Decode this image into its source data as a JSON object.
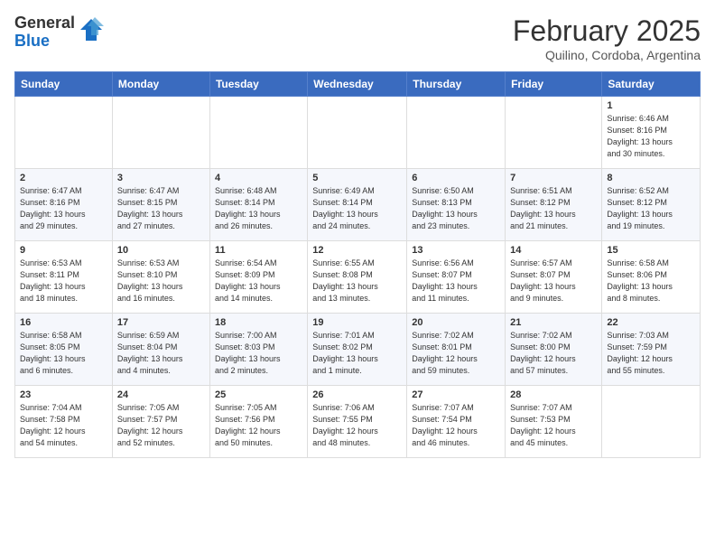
{
  "logo": {
    "general": "General",
    "blue": "Blue"
  },
  "title": "February 2025",
  "location": "Quilino, Cordoba, Argentina",
  "days_of_week": [
    "Sunday",
    "Monday",
    "Tuesday",
    "Wednesday",
    "Thursday",
    "Friday",
    "Saturday"
  ],
  "weeks": [
    [
      {
        "day": "",
        "info": ""
      },
      {
        "day": "",
        "info": ""
      },
      {
        "day": "",
        "info": ""
      },
      {
        "day": "",
        "info": ""
      },
      {
        "day": "",
        "info": ""
      },
      {
        "day": "",
        "info": ""
      },
      {
        "day": "1",
        "info": "Sunrise: 6:46 AM\nSunset: 8:16 PM\nDaylight: 13 hours\nand 30 minutes."
      }
    ],
    [
      {
        "day": "2",
        "info": "Sunrise: 6:47 AM\nSunset: 8:16 PM\nDaylight: 13 hours\nand 29 minutes."
      },
      {
        "day": "3",
        "info": "Sunrise: 6:47 AM\nSunset: 8:15 PM\nDaylight: 13 hours\nand 27 minutes."
      },
      {
        "day": "4",
        "info": "Sunrise: 6:48 AM\nSunset: 8:14 PM\nDaylight: 13 hours\nand 26 minutes."
      },
      {
        "day": "5",
        "info": "Sunrise: 6:49 AM\nSunset: 8:14 PM\nDaylight: 13 hours\nand 24 minutes."
      },
      {
        "day": "6",
        "info": "Sunrise: 6:50 AM\nSunset: 8:13 PM\nDaylight: 13 hours\nand 23 minutes."
      },
      {
        "day": "7",
        "info": "Sunrise: 6:51 AM\nSunset: 8:12 PM\nDaylight: 13 hours\nand 21 minutes."
      },
      {
        "day": "8",
        "info": "Sunrise: 6:52 AM\nSunset: 8:12 PM\nDaylight: 13 hours\nand 19 minutes."
      }
    ],
    [
      {
        "day": "9",
        "info": "Sunrise: 6:53 AM\nSunset: 8:11 PM\nDaylight: 13 hours\nand 18 minutes."
      },
      {
        "day": "10",
        "info": "Sunrise: 6:53 AM\nSunset: 8:10 PM\nDaylight: 13 hours\nand 16 minutes."
      },
      {
        "day": "11",
        "info": "Sunrise: 6:54 AM\nSunset: 8:09 PM\nDaylight: 13 hours\nand 14 minutes."
      },
      {
        "day": "12",
        "info": "Sunrise: 6:55 AM\nSunset: 8:08 PM\nDaylight: 13 hours\nand 13 minutes."
      },
      {
        "day": "13",
        "info": "Sunrise: 6:56 AM\nSunset: 8:07 PM\nDaylight: 13 hours\nand 11 minutes."
      },
      {
        "day": "14",
        "info": "Sunrise: 6:57 AM\nSunset: 8:07 PM\nDaylight: 13 hours\nand 9 minutes."
      },
      {
        "day": "15",
        "info": "Sunrise: 6:58 AM\nSunset: 8:06 PM\nDaylight: 13 hours\nand 8 minutes."
      }
    ],
    [
      {
        "day": "16",
        "info": "Sunrise: 6:58 AM\nSunset: 8:05 PM\nDaylight: 13 hours\nand 6 minutes."
      },
      {
        "day": "17",
        "info": "Sunrise: 6:59 AM\nSunset: 8:04 PM\nDaylight: 13 hours\nand 4 minutes."
      },
      {
        "day": "18",
        "info": "Sunrise: 7:00 AM\nSunset: 8:03 PM\nDaylight: 13 hours\nand 2 minutes."
      },
      {
        "day": "19",
        "info": "Sunrise: 7:01 AM\nSunset: 8:02 PM\nDaylight: 13 hours\nand 1 minute."
      },
      {
        "day": "20",
        "info": "Sunrise: 7:02 AM\nSunset: 8:01 PM\nDaylight: 12 hours\nand 59 minutes."
      },
      {
        "day": "21",
        "info": "Sunrise: 7:02 AM\nSunset: 8:00 PM\nDaylight: 12 hours\nand 57 minutes."
      },
      {
        "day": "22",
        "info": "Sunrise: 7:03 AM\nSunset: 7:59 PM\nDaylight: 12 hours\nand 55 minutes."
      }
    ],
    [
      {
        "day": "23",
        "info": "Sunrise: 7:04 AM\nSunset: 7:58 PM\nDaylight: 12 hours\nand 54 minutes."
      },
      {
        "day": "24",
        "info": "Sunrise: 7:05 AM\nSunset: 7:57 PM\nDaylight: 12 hours\nand 52 minutes."
      },
      {
        "day": "25",
        "info": "Sunrise: 7:05 AM\nSunset: 7:56 PM\nDaylight: 12 hours\nand 50 minutes."
      },
      {
        "day": "26",
        "info": "Sunrise: 7:06 AM\nSunset: 7:55 PM\nDaylight: 12 hours\nand 48 minutes."
      },
      {
        "day": "27",
        "info": "Sunrise: 7:07 AM\nSunset: 7:54 PM\nDaylight: 12 hours\nand 46 minutes."
      },
      {
        "day": "28",
        "info": "Sunrise: 7:07 AM\nSunset: 7:53 PM\nDaylight: 12 hours\nand 45 minutes."
      },
      {
        "day": "",
        "info": ""
      }
    ]
  ]
}
